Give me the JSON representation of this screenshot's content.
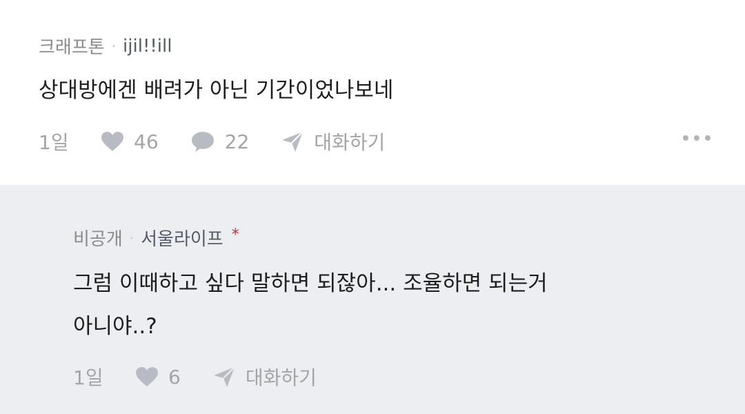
{
  "comment": {
    "category": "크래프톤",
    "separator": "·",
    "author": "ijil!!ill",
    "text": "상대방에겐 배려가 아닌 기간이었나보네",
    "time": "1일",
    "likes": "46",
    "replies": "22",
    "chat_label": "대화하기"
  },
  "reply": {
    "category": "비공개",
    "separator": "·",
    "author": "서울라이프",
    "author_mark": "*",
    "text_line1": "그럼 이때하고 싶다 말하면 되잖아... 조율하면 되는거",
    "text_line2": "아니야..?",
    "time": "1일",
    "likes": "6",
    "chat_label": "대화하기"
  },
  "colors": {
    "reply_background": "#eceef2",
    "accent_star": "#d9283a",
    "muted_text": "#a4a4a4"
  },
  "icons": [
    "heart-icon",
    "speech-bubble-icon",
    "send-icon",
    "more-options-icon"
  ]
}
